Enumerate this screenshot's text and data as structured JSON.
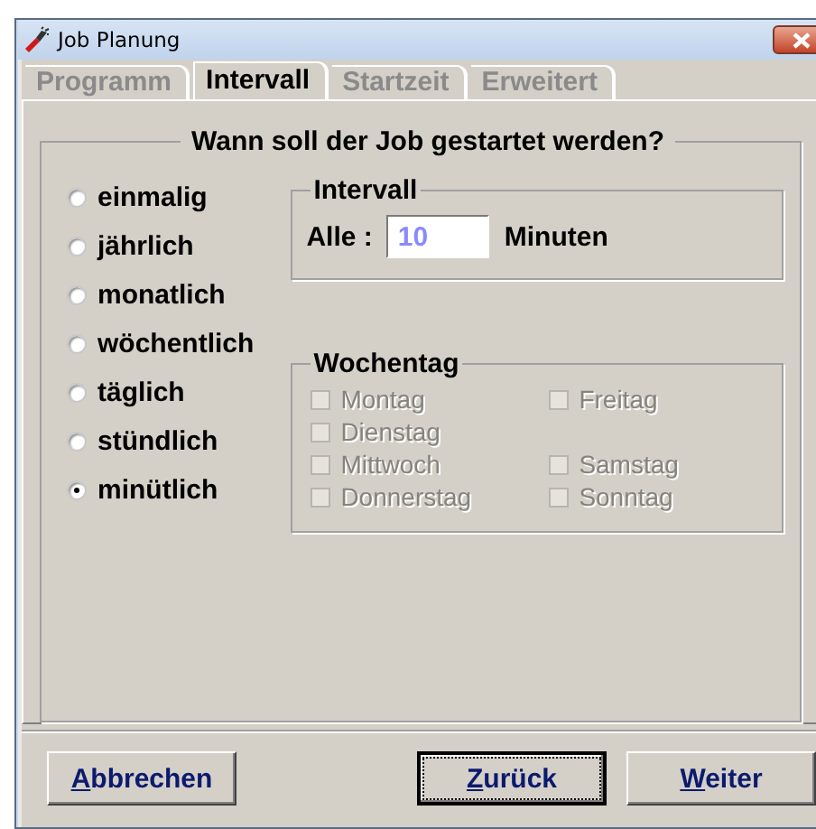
{
  "window": {
    "title": "Job Planung"
  },
  "tabs": [
    {
      "label": "Programm",
      "selected": false
    },
    {
      "label": "Intervall",
      "selected": true
    },
    {
      "label": "Startzeit",
      "selected": false
    },
    {
      "label": "Erweitert",
      "selected": false
    }
  ],
  "group": {
    "title": "Wann soll der Job gestartet werden?"
  },
  "frequency": [
    {
      "label": "einmalig",
      "selected": false
    },
    {
      "label": "jährlich",
      "selected": false
    },
    {
      "label": "monatlich",
      "selected": false
    },
    {
      "label": "wöchentlich",
      "selected": false
    },
    {
      "label": "täglich",
      "selected": false
    },
    {
      "label": "stündlich",
      "selected": false
    },
    {
      "label": "minütlich",
      "selected": true
    }
  ],
  "interval": {
    "title": "Intervall",
    "label": "Alle :",
    "value": "10",
    "unit": "Minuten"
  },
  "weekdays": {
    "title": "Wochentag",
    "rows": [
      [
        {
          "label": "Montag",
          "checked": false,
          "disabled": true
        },
        {
          "label": "Freitag",
          "checked": false,
          "disabled": true
        }
      ],
      [
        {
          "label": "Dienstag",
          "checked": false,
          "disabled": true
        }
      ],
      [
        {
          "label": "Mittwoch",
          "checked": false,
          "disabled": true
        },
        {
          "label": "Samstag",
          "checked": false,
          "disabled": true
        }
      ],
      [
        {
          "label": "Donnerstag",
          "checked": false,
          "disabled": true
        },
        {
          "label": "Sonntag",
          "checked": false,
          "disabled": true
        }
      ]
    ]
  },
  "buttons": [
    {
      "label": "Abbrechen",
      "focused": false
    },
    {
      "label": "Zurück",
      "focused": true
    },
    {
      "label": "Weiter",
      "focused": false
    }
  ]
}
